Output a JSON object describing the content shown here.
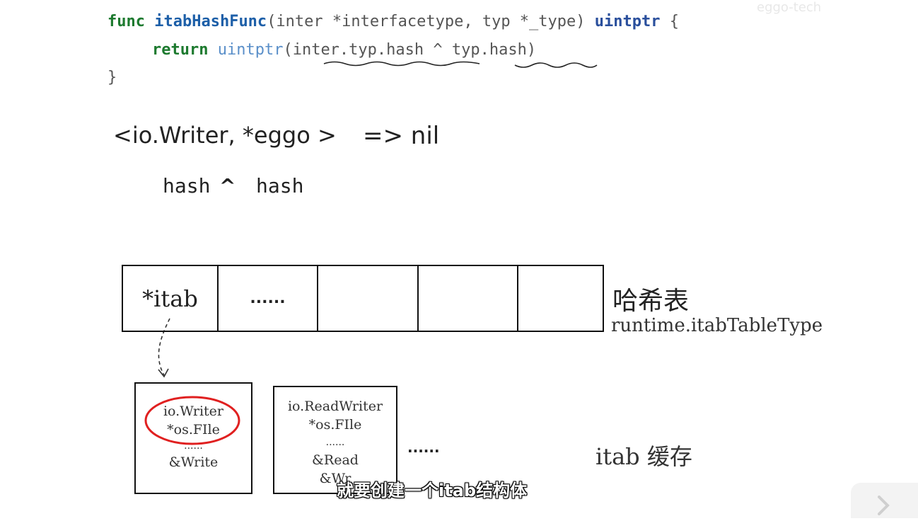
{
  "code": {
    "line1": {
      "kw_func": "func",
      "fn_name": "itabHashFunc",
      "params": "(inter *interfacetype, typ *_type)",
      "ret_type": "uintptr",
      "brace_open": "{"
    },
    "line2": {
      "kw_return": "return",
      "call": "uintptr",
      "paren_open": "(",
      "arg1": "inter.typ.hash",
      "op": " ^ ",
      "arg2": "typ.hash",
      "paren_close": ")"
    },
    "line3": {
      "brace_close": "}"
    }
  },
  "notes": {
    "pair": "<io.Writer, *eggo >",
    "arrow_result": "=> nil",
    "hash_left": "hash",
    "caret": "^",
    "hash_right": "hash"
  },
  "hash_table": {
    "cells": [
      "*itab",
      "......",
      "",
      "",
      ""
    ],
    "label_cn": "哈希表",
    "label_type": "runtime.itabTableType"
  },
  "itab_cards": [
    {
      "lines": [
        "io.Writer",
        "*os.FIle",
        "......",
        "&Write"
      ]
    },
    {
      "lines": [
        "io.ReadWriter",
        "*os.FIle",
        "......",
        "&Read",
        "&Wr"
      ]
    }
  ],
  "cards_ellipsis": "......",
  "cache_label": "itab 缓存",
  "subtitle": "就要创建一个itab结构体",
  "watermark": "eggo-tech",
  "colors": {
    "keyword": "#1d7a2f",
    "function": "#1d5fa8",
    "highlight_circle": "#e02020"
  }
}
